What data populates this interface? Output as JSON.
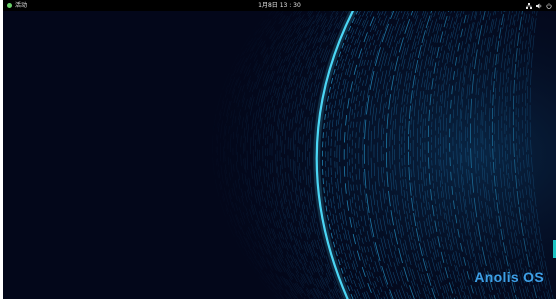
{
  "topbar": {
    "activities_label": "活动",
    "clock": "1月8日 13 : 30",
    "tray_icons": [
      "network-icon",
      "volume-icon",
      "power-icon"
    ]
  },
  "desktop": {
    "brand": "Anolis OS"
  },
  "colors": {
    "topbar_bg": "#000000",
    "desktop_bg": "#03071a",
    "accent": "#3d9fe6",
    "activities_icon": "#6bd16b"
  }
}
